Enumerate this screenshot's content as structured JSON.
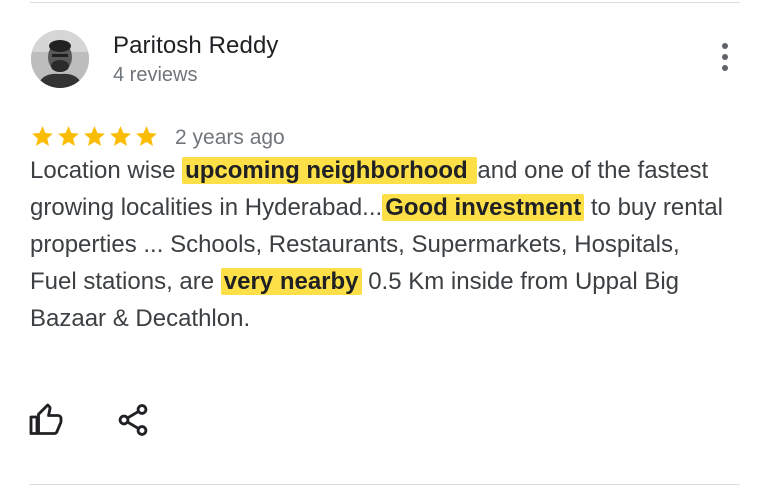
{
  "review": {
    "author": "Paritosh Reddy",
    "meta": "4 reviews",
    "rating": 5,
    "rating_max": 5,
    "date": "2 years ago",
    "text": {
      "seg1": "Location wise ",
      "hl1": "upcoming neighborhood ",
      "seg2": " and one of the fastest growing localities in Hyderabad...",
      "hl2": "Good investment",
      "seg3": " to buy rental properties ... Schools, Restaurants, Supermarkets, Hospitals, Fuel stations, are ",
      "hl3": "very nearby",
      "seg4": " 0.5 Km inside from Uppal Big Bazaar & Decathlon."
    }
  },
  "icons": {
    "more": "more-vert-icon",
    "like": "thumb-up-icon",
    "share": "share-icon",
    "star": "star-icon"
  },
  "colors": {
    "star": "#fbbc04",
    "highlight": "#fde047",
    "text": "#3c4043",
    "secondary_text": "#70757a"
  }
}
